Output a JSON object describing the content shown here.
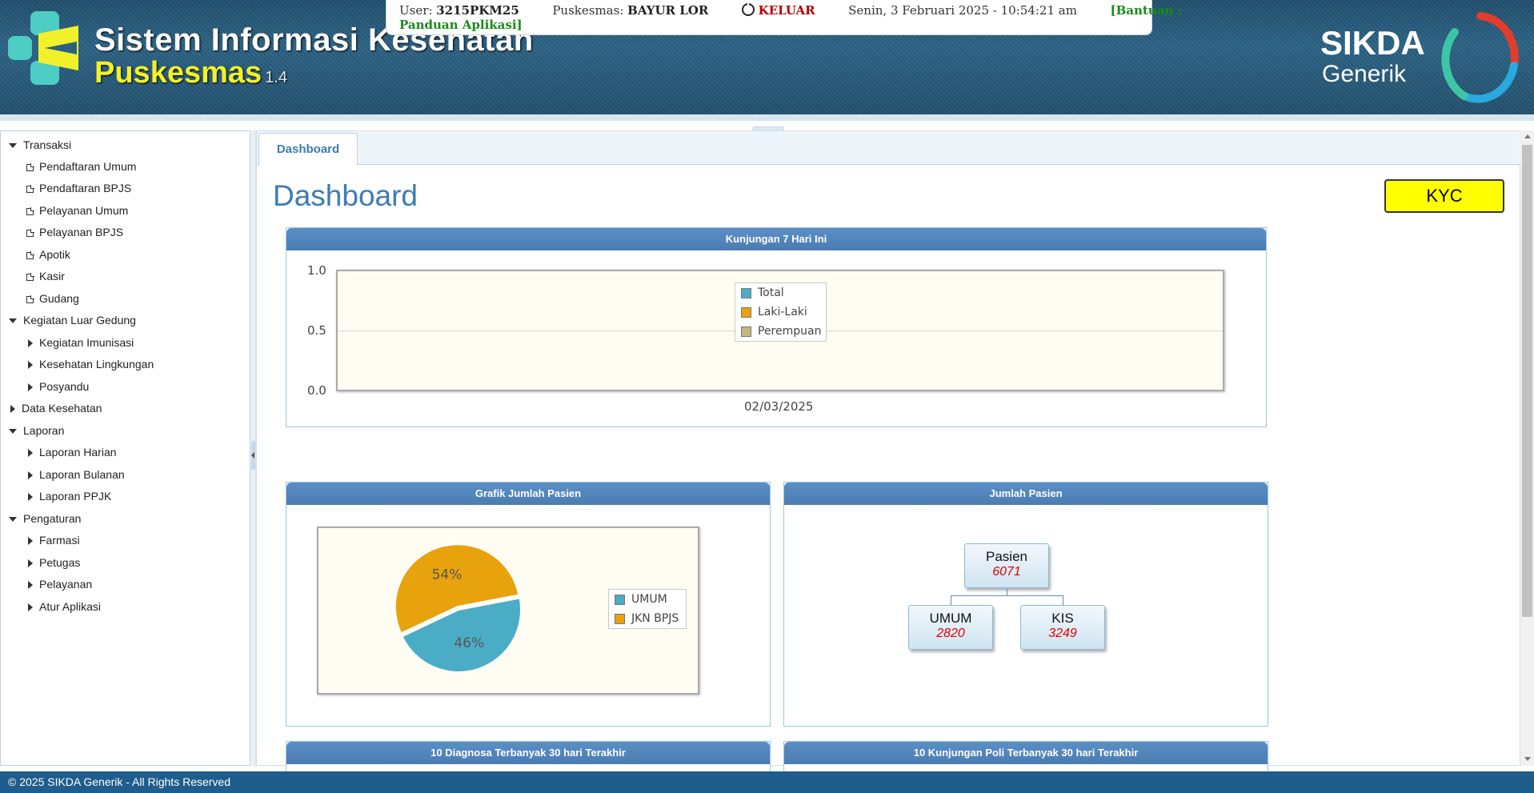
{
  "header": {
    "title": "Sistem Informasi Kesehatan",
    "subtitle": "Puskesmas",
    "version": "1.4",
    "brand_line1": "SIKDA",
    "brand_line2": "Generik"
  },
  "infobar": {
    "user_label": "User:",
    "user_value": "3215PKM25",
    "puskesmas_label": "Puskesmas:",
    "puskesmas_value": "BAYUR LOR",
    "logout_label": "KELUAR",
    "datetime": "Senin, 3 Februari 2025 - 10:54:21 am",
    "help_label": "[Bantuan :",
    "help_label2": "Panduan Aplikasi]"
  },
  "sidebar": {
    "groups": [
      {
        "label": "Transaksi",
        "expanded": true,
        "items": [
          "Pendaftaran Umum",
          "Pendaftaran BPJS",
          "Pelayanan Umum",
          "Pelayanan BPJS",
          "Apotik",
          "Kasir",
          "Gudang"
        ],
        "leaf": true
      },
      {
        "label": "Kegiatan Luar Gedung",
        "expanded": true,
        "items": [
          "Kegiatan Imunisasi",
          "Kesehatan Lingkungan",
          "Posyandu"
        ],
        "leaf": false
      },
      {
        "label": "Data Kesehatan",
        "expanded": false,
        "items": [],
        "leaf": false
      },
      {
        "label": "Laporan",
        "expanded": true,
        "items": [
          "Laporan Harian",
          "Laporan Bulanan",
          "Laporan PPJK"
        ],
        "leaf": false
      },
      {
        "label": "Pengaturan",
        "expanded": true,
        "items": [
          "Farmasi",
          "Petugas",
          "Pelayanan",
          "Atur Aplikasi"
        ],
        "leaf": false
      }
    ]
  },
  "tabs": {
    "active": "Dashboard"
  },
  "page": {
    "title": "Dashboard",
    "kyc_label": "KYC"
  },
  "panels": {
    "kunjungan": "Kunjungan 7 Hari Ini",
    "grafik": "Grafik Jumlah Pasien",
    "jumlah": "Jumlah Pasien",
    "diagnosa": "10 Diagnosa Terbanyak 30 hari Terakhir",
    "poli": "10 Kunjungan Poli Terbanyak 30 hari Terakhir"
  },
  "chart_data": [
    {
      "type": "line",
      "title": "Kunjungan 7 Hari Ini",
      "x": [
        "02/03/2025"
      ],
      "yticks": [
        "1.0",
        "0.5",
        "0.0"
      ],
      "ylim": [
        0,
        1
      ],
      "series": [
        {
          "name": "Total",
          "values": [],
          "color": "#4bacc6"
        },
        {
          "name": "Laki-Laki",
          "values": [],
          "color": "#e8a20c"
        },
        {
          "name": "Perempuan",
          "values": [],
          "color": "#c5b47f"
        }
      ],
      "legend": "top-center",
      "grid": true
    },
    {
      "type": "pie",
      "title": "Grafik Jumlah Pasien",
      "slices": [
        {
          "name": "UMUM",
          "value": 46,
          "label": "46%",
          "color": "#4bacc6"
        },
        {
          "name": "JKN BPJS",
          "value": 54,
          "label": "54%",
          "color": "#e8a20c"
        }
      ],
      "legend": "right"
    }
  ],
  "orgchart": {
    "root": {
      "name": "Pasien",
      "value": "6071"
    },
    "children": [
      {
        "name": "UMUM",
        "value": "2820"
      },
      {
        "name": "KIS",
        "value": "3249"
      }
    ]
  },
  "footer": {
    "text": "© 2025 SIKDA Generik - All Rights Reserved"
  }
}
